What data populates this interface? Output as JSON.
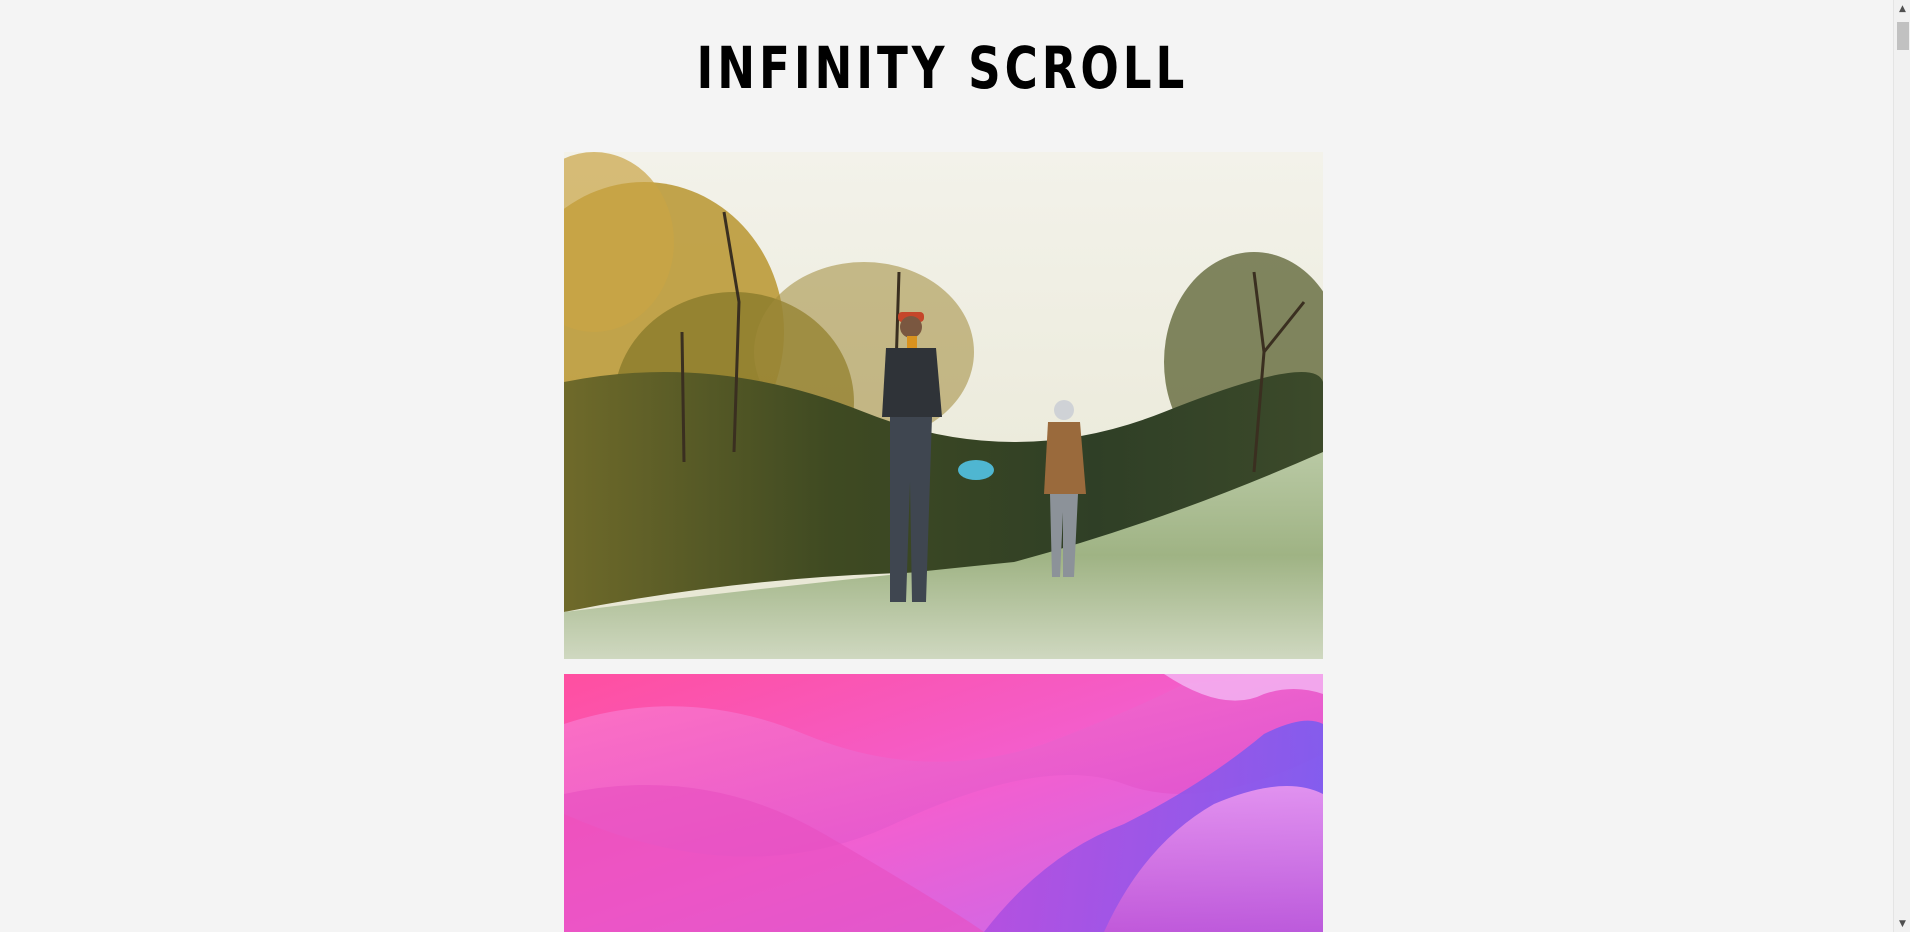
{
  "page": {
    "title": "INFINITY SCROLL"
  },
  "images": [
    {
      "subject": "two people standing on a frosty grass hill in an autumn forest, one holding a blue disc"
    },
    {
      "subject": "abstract pink and purple flowing 3D waves"
    }
  ],
  "scrollbar": {
    "up_icon": "triangle-up",
    "down_icon": "triangle-down"
  },
  "colors": {
    "background": "#f4f4f4",
    "title": "#000000"
  }
}
